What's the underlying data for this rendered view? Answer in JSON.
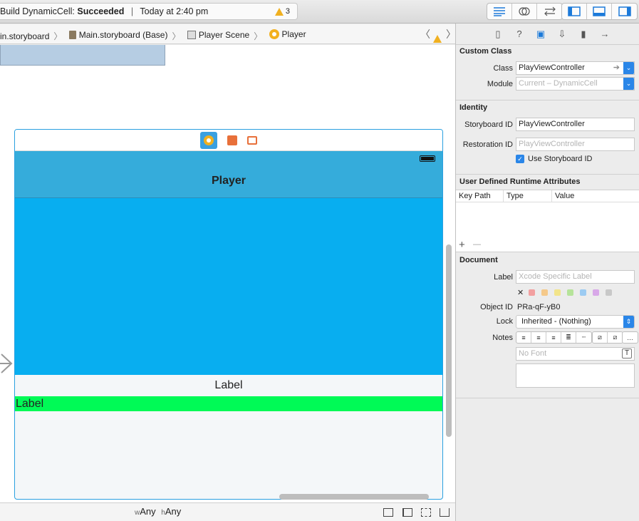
{
  "toolbar": {
    "status_prefix": "Build DynamicCell:",
    "status_result": "Succeeded",
    "status_time": "Today at 2:40 pm",
    "warning_count": "3"
  },
  "jumpbar": {
    "crumbs": [
      "in.storyboard",
      "Main.storyboard (Base)",
      "Player Scene",
      "Player"
    ]
  },
  "scene": {
    "nav_title": "Player",
    "label_center": "Label",
    "label_left": "Label"
  },
  "bottombar": {
    "w_prefix": "w",
    "w_value": "Any",
    "h_prefix": "h",
    "h_value": "Any"
  },
  "inspector": {
    "custom_class": {
      "title": "Custom Class",
      "class_label": "Class",
      "class_value": "PlayViewController",
      "module_label": "Module",
      "module_placeholder": "Current – DynamicCell"
    },
    "identity": {
      "title": "Identity",
      "storyboard_id_label": "Storyboard ID",
      "storyboard_id_value": "PlayViewController",
      "restoration_id_label": "Restoration ID",
      "restoration_id_placeholder": "PlayViewController",
      "use_storyboard_label": "Use Storyboard ID",
      "use_storyboard_checked": true
    },
    "runtime_attrs": {
      "title": "User Defined Runtime Attributes",
      "col_key_path": "Key Path",
      "col_type": "Type",
      "col_value": "Value",
      "add": "+",
      "remove": "—"
    },
    "document": {
      "title": "Document",
      "label_label": "Label",
      "label_placeholder": "Xcode Specific Label",
      "clear_glyph": "✕",
      "swatches": [
        "#f2a0a0",
        "#f5c98a",
        "#f2e48a",
        "#b6e39a",
        "#9ccbf2",
        "#d8a8e8",
        "#c8c8c8"
      ],
      "object_id_label": "Object ID",
      "object_id_value": "PRa-qF-yB0",
      "lock_label": "Lock",
      "lock_value": "Inherited - (Nothing)",
      "notes_label": "Notes",
      "font_placeholder": "No Font",
      "more_glyph": "…",
      "font_button": "T"
    }
  },
  "colors": {
    "accent": "#2a86e8",
    "nav_bar": "#35acdb",
    "content_view": "#08aef0",
    "green_label": "#00fa56",
    "scene_border": "#2aa0e0"
  }
}
